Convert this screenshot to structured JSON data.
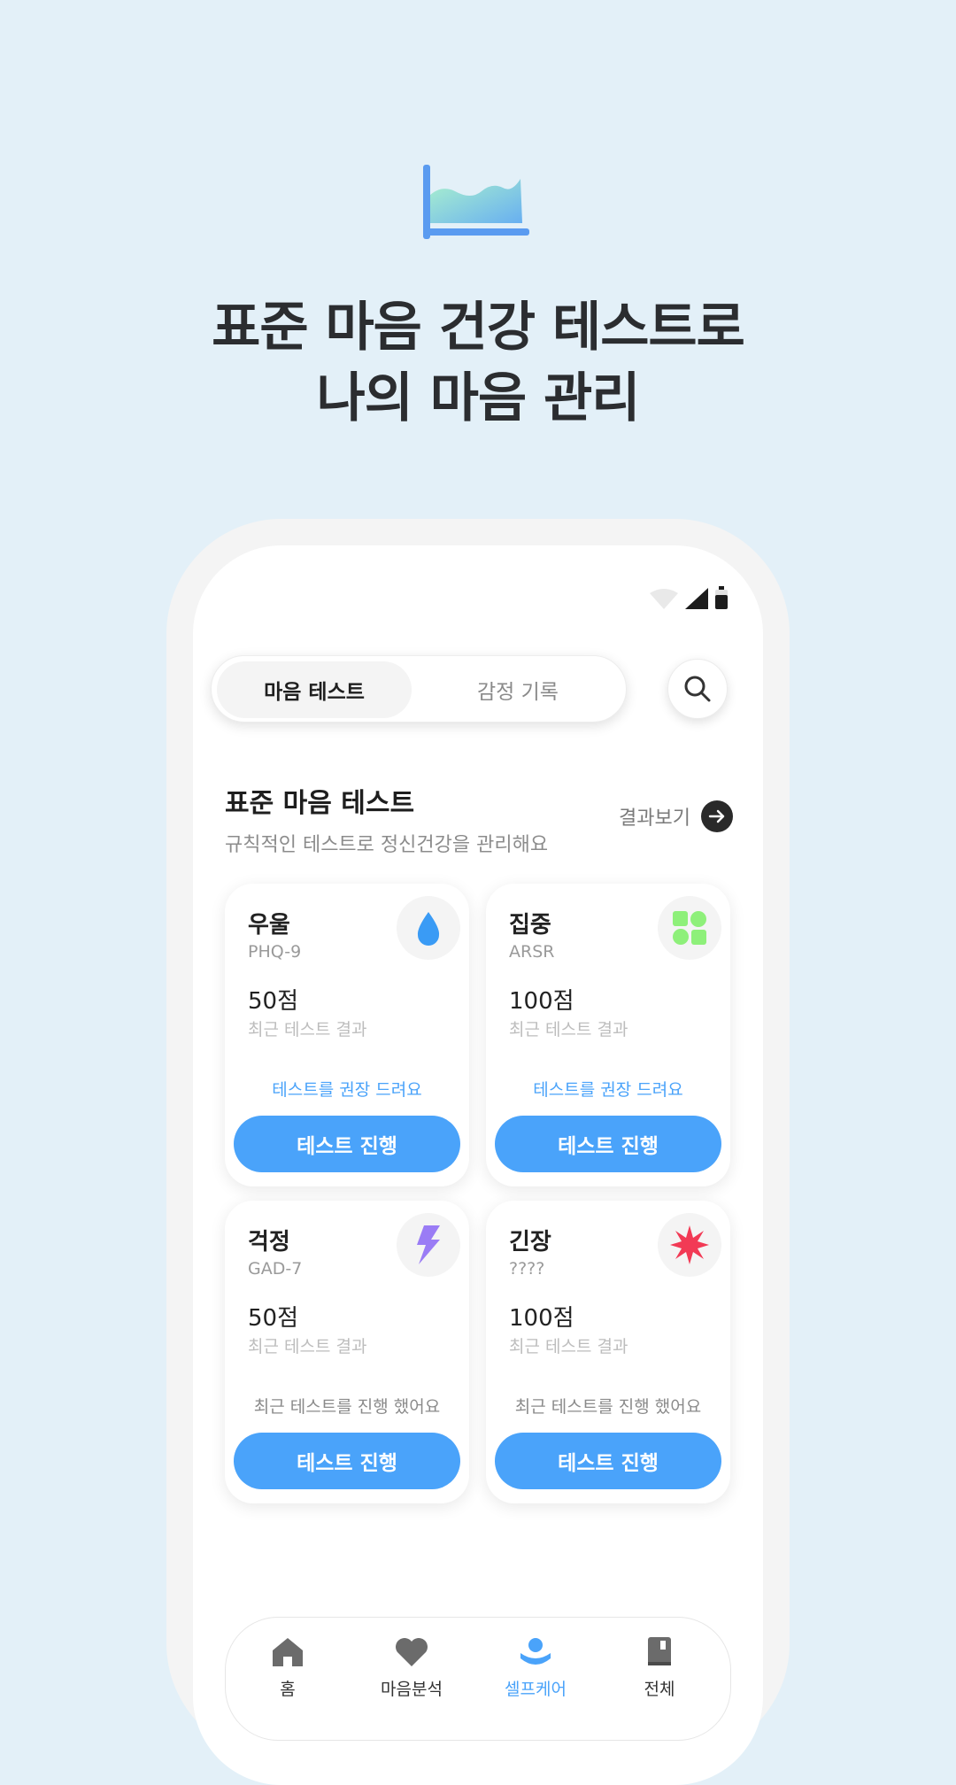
{
  "hero": {
    "title_line1": "표준 마음 건강 테스트로",
    "title_line2": "나의 마음 관리"
  },
  "tabs": {
    "active": "마음 테스트",
    "inactive": "감정 기록"
  },
  "section": {
    "title": "표준 마음 테스트",
    "subtitle": "규칙적인 테스트로 정신건강을 관리해요",
    "result_link": "결과보기"
  },
  "cards": [
    {
      "name": "우울",
      "code": "PHQ-9",
      "score": "50점",
      "score_label": "최근 테스트 결과",
      "message": "테스트를 권장 드려요",
      "message_color": "#4aa3fa",
      "button": "테스트 진행",
      "icon": "water-drop-icon",
      "icon_color": "#3a9bf5"
    },
    {
      "name": "집중",
      "code": "ARSR",
      "score": "100점",
      "score_label": "최근 테스트 결과",
      "message": "테스트를 권장 드려요",
      "message_color": "#4aa3fa",
      "button": "테스트 진행",
      "icon": "shapes-icon",
      "icon_color": "#8ef07a"
    },
    {
      "name": "걱정",
      "code": "GAD-7",
      "score": "50점",
      "score_label": "최근 테스트 결과",
      "message": "최근 테스트를 진행 했어요",
      "message_color": "#8a8a8a",
      "button": "테스트 진행",
      "icon": "lightning-icon",
      "icon_color": "#9a7cf5"
    },
    {
      "name": "긴장",
      "code": "????",
      "score": "100점",
      "score_label": "최근 테스트 결과",
      "message": "최근 테스트를 진행 했어요",
      "message_color": "#8a8a8a",
      "button": "테스트 진행",
      "icon": "burst-icon",
      "icon_color": "#f23a55"
    }
  ],
  "nav": [
    {
      "label": "홈",
      "icon": "home-icon"
    },
    {
      "label": "마음분석",
      "icon": "heart-icon"
    },
    {
      "label": "셀프케어",
      "icon": "selfcare-icon",
      "active": true
    },
    {
      "label": "전체",
      "icon": "book-icon"
    }
  ],
  "colors": {
    "background": "#e3f0f8",
    "accent": "#4aa3fa",
    "text": "#2b2d30"
  }
}
